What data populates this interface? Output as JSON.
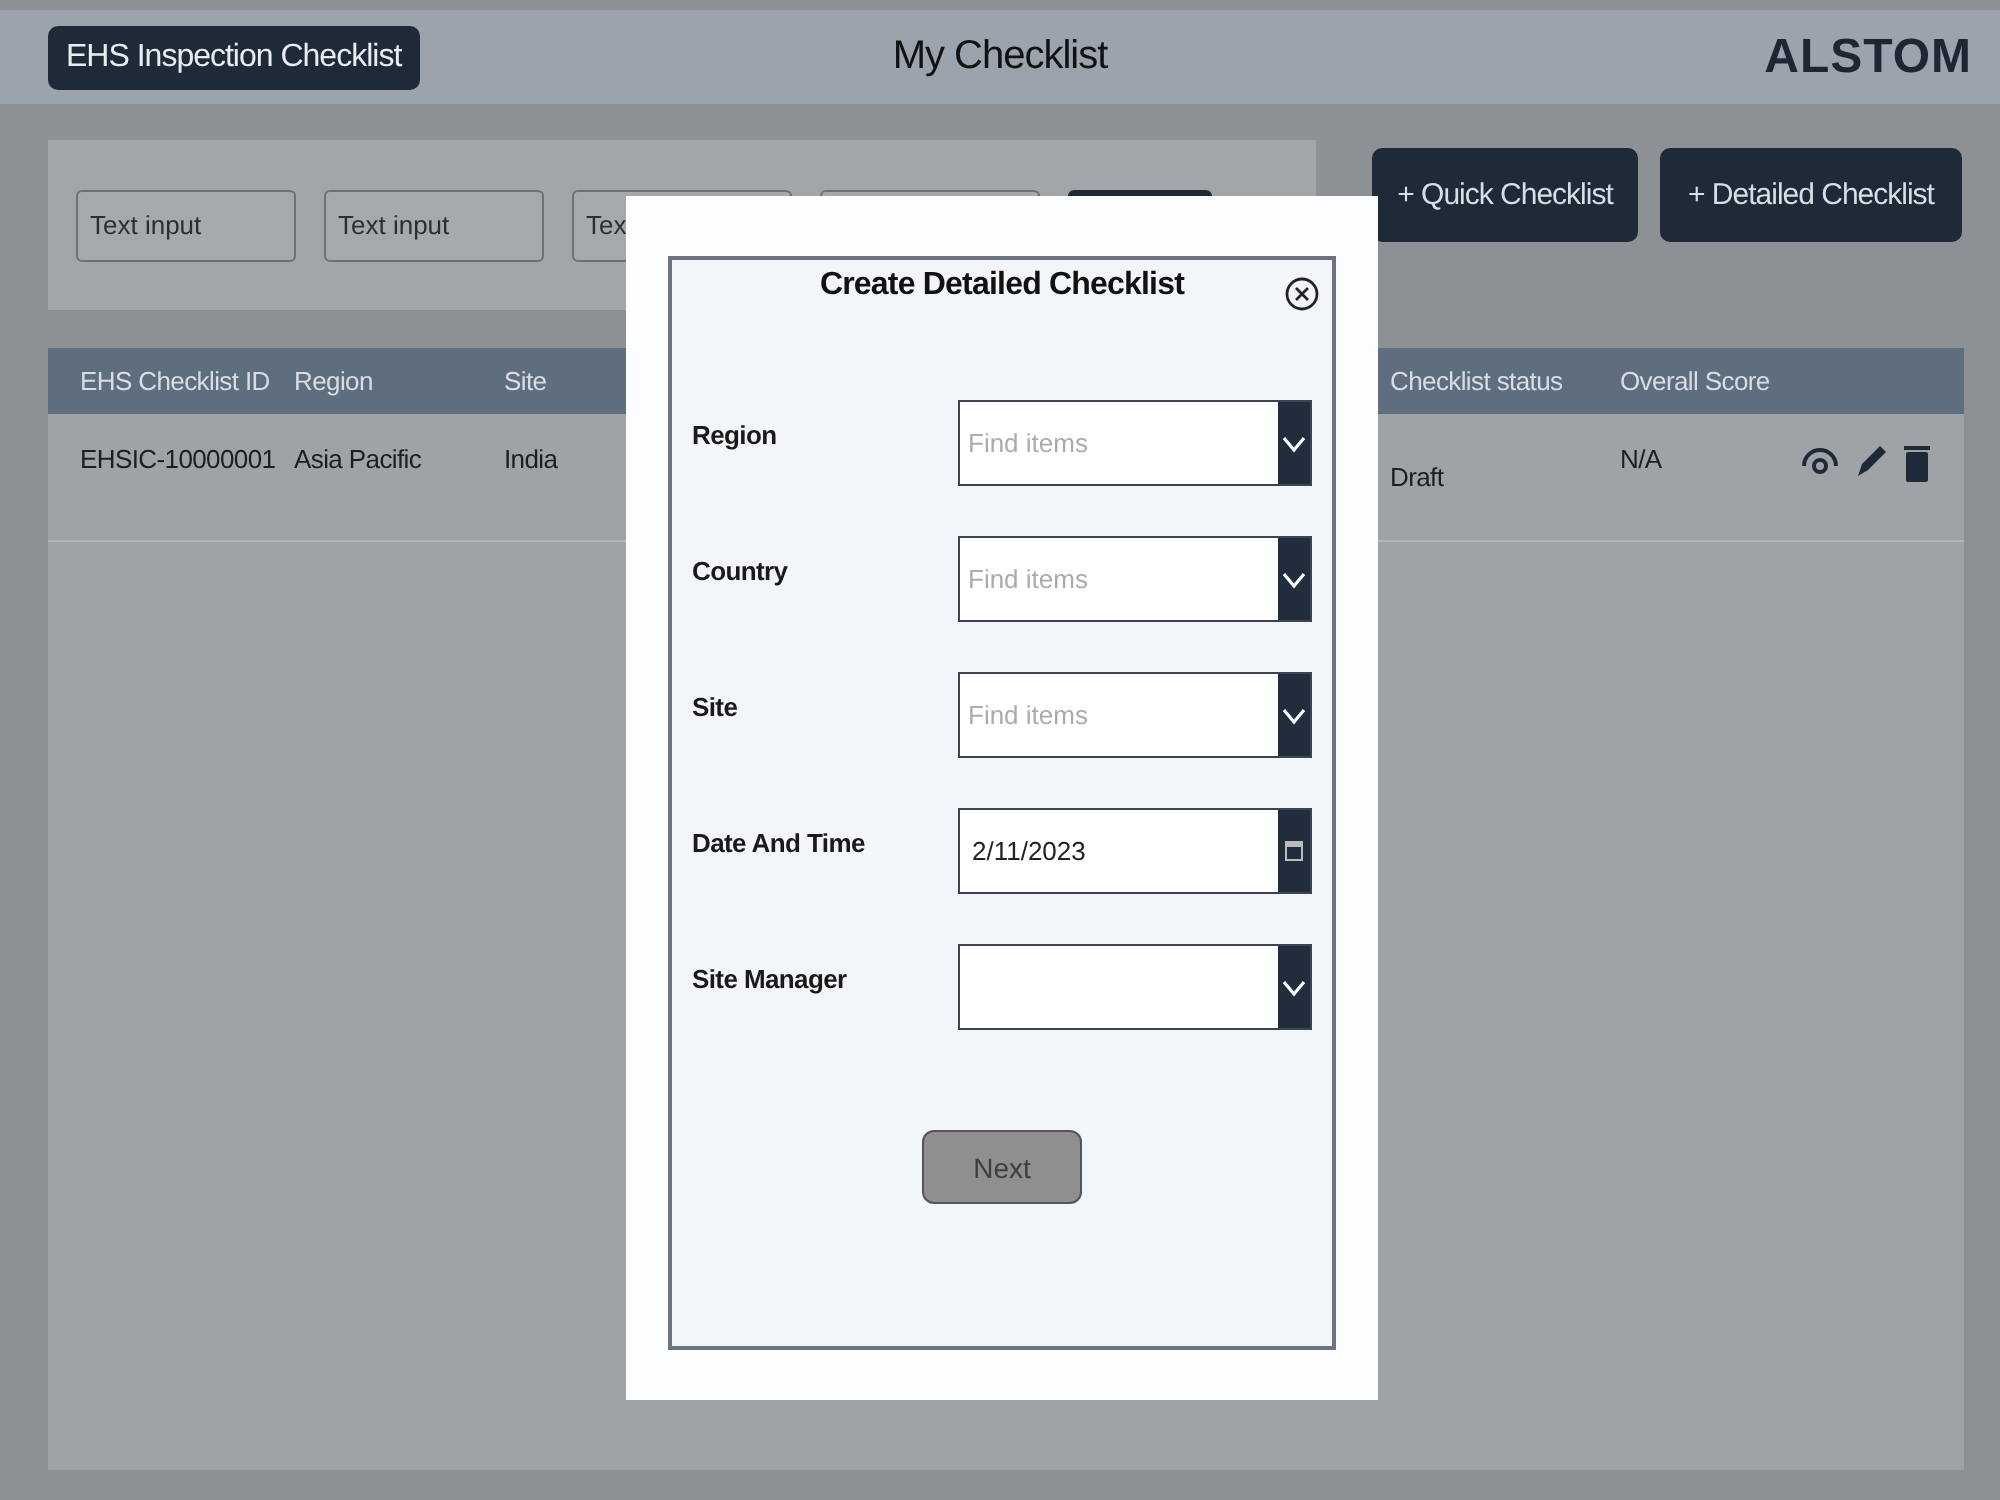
{
  "header": {
    "app_title": "EHS Inspection Checklist",
    "page_title": "My Checklist",
    "logo": "ALSTOM"
  },
  "filters": [
    {
      "kind": "input",
      "placeholder": "Text input"
    },
    {
      "kind": "input",
      "placeholder": "Text input"
    },
    {
      "kind": "input",
      "placeholder": "Tex"
    },
    {
      "kind": "input"
    },
    {
      "kind": "button"
    }
  ],
  "actions": [
    "+ Quick Checklist",
    "+ Detailed Checklist"
  ],
  "table": {
    "columns": [
      "EHS Checklist ID",
      "Region",
      "Site",
      "Checklist status",
      "Overall Score"
    ],
    "rows": [
      {
        "cells": [
          "EHSIC-10000001",
          "Asia Pacific",
          "India",
          "Draft",
          "N/A"
        ]
      }
    ]
  },
  "dialog": {
    "title": "Create Detailed Checklist",
    "fields": [
      {
        "label": "Region",
        "kind": "dropdown",
        "placeholder": "Find items"
      },
      {
        "label": "Country",
        "kind": "dropdown",
        "placeholder": "Find items"
      },
      {
        "label": "Site",
        "kind": "dropdown",
        "placeholder": "Find items"
      },
      {
        "label": "Date And Time",
        "kind": "date",
        "value": "2/11/2023"
      },
      {
        "label": "Site Manager",
        "kind": "dropdown"
      }
    ],
    "next_button": {
      "label": "Next",
      "disabled": true
    }
  }
}
